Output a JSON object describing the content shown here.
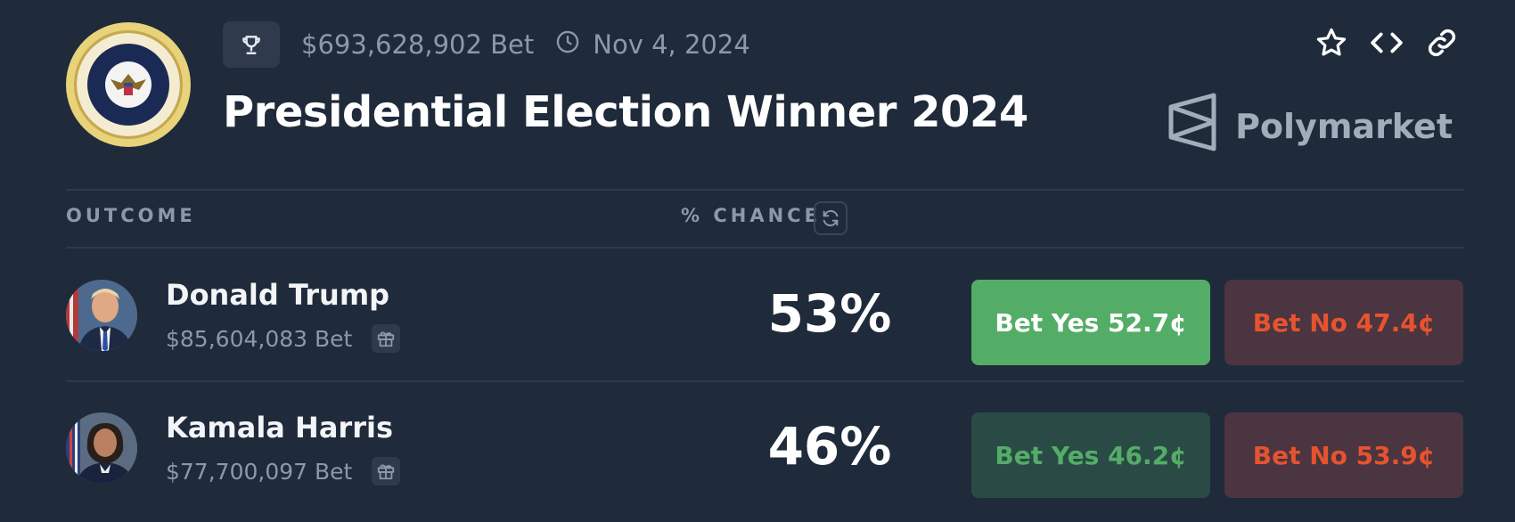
{
  "header": {
    "volume": "$693,628,902 Bet",
    "date": "Nov 4, 2024",
    "title": "Presidential Election Winner 2024",
    "brand": "Polymarket"
  },
  "table": {
    "col_outcome": "OUTCOME",
    "col_chance": "% CHANCE"
  },
  "rows": [
    {
      "name": "Donald Trump",
      "volume": "$85,604,083 Bet",
      "chance": "53%",
      "yes_label": "Bet Yes 52.7¢",
      "no_label": "Bet No 47.4¢"
    },
    {
      "name": "Kamala Harris",
      "volume": "$77,700,097 Bet",
      "chance": "46%",
      "yes_label": "Bet Yes 46.2¢",
      "no_label": "Bet No 53.9¢"
    }
  ],
  "colors": {
    "background": "#1f2a3a",
    "yes_green": "#54ad67",
    "no_red": "#e6532e"
  },
  "icons": [
    "presidential-seal-icon",
    "trophy-icon",
    "clock-icon",
    "star-icon",
    "code-icon",
    "link-icon",
    "polymarket-logo-icon",
    "refresh-icon",
    "gift-icon"
  ]
}
